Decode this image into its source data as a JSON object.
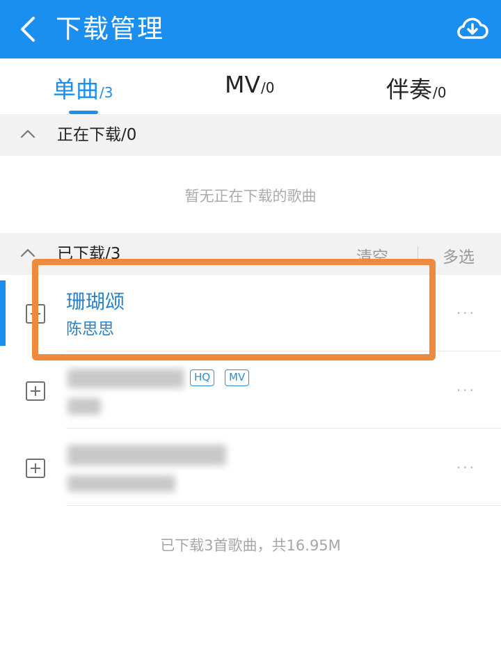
{
  "header": {
    "title": "下载管理",
    "back_icon": "back-arrow-icon",
    "download_icon": "cloud-download-icon",
    "accent_color": "#1a8ff0"
  },
  "tabs": [
    {
      "label": "单曲",
      "count": "/3",
      "active": true
    },
    {
      "label": "MV",
      "count": "/0",
      "active": false
    },
    {
      "label": "伴奏",
      "count": "/0",
      "active": false
    }
  ],
  "downloading": {
    "title": "正在下载/0",
    "empty_text": "暂无正在下载的歌曲"
  },
  "downloaded": {
    "title": "已下载/3",
    "clear_label": "清空",
    "multi_select_label": "多选",
    "songs": [
      {
        "title": "珊瑚颂",
        "artist": "陈思思",
        "more": "···"
      },
      {
        "title": "",
        "artist": "",
        "badges": [
          "HQ",
          "MV"
        ],
        "more": "···"
      },
      {
        "title": "",
        "artist": "",
        "more": "···"
      }
    ]
  },
  "summary": "已下载3首歌曲，共16.95M",
  "colors": {
    "accent": "#1a8ff0",
    "song_text": "#2a82c8",
    "highlight": "#ee8a3e"
  }
}
